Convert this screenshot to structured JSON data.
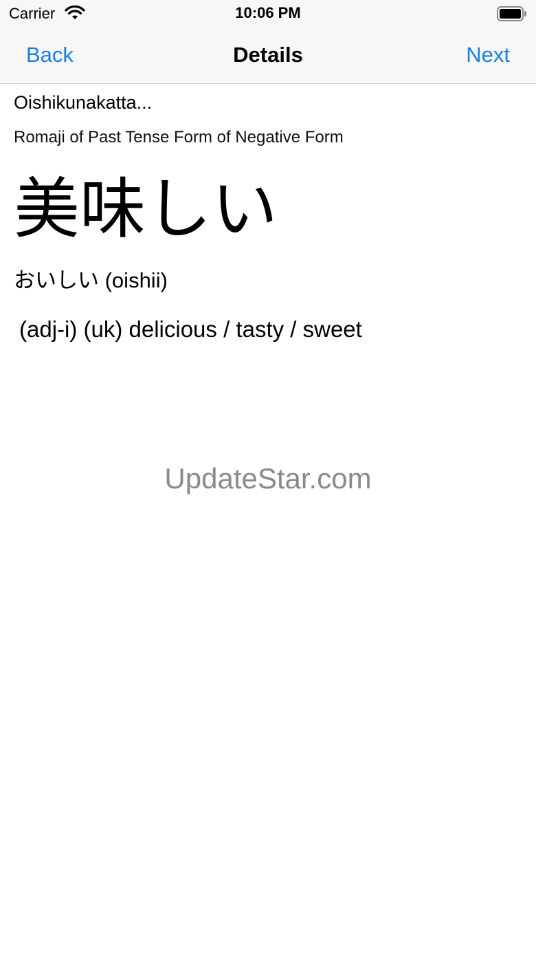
{
  "status_bar": {
    "carrier": "Carrier",
    "time": "10:06 PM"
  },
  "nav": {
    "back_label": "Back",
    "title": "Details",
    "next_label": "Next"
  },
  "entry": {
    "romaji": "Oishikunakatta...",
    "romaji_description": "Romaji of Past Tense Form of Negative Form",
    "kanji": "美味しい",
    "kana_reading": "おいしい (oishii)",
    "meaning": "(adj-i) (uk) delicious / tasty / sweet"
  },
  "watermark": "UpdateStar.com",
  "colors": {
    "accent": "#1a7fe0",
    "nav_background": "#f7f7f7",
    "watermark": "#8a8a8a"
  },
  "icons": [
    "wifi-icon",
    "battery-icon"
  ]
}
